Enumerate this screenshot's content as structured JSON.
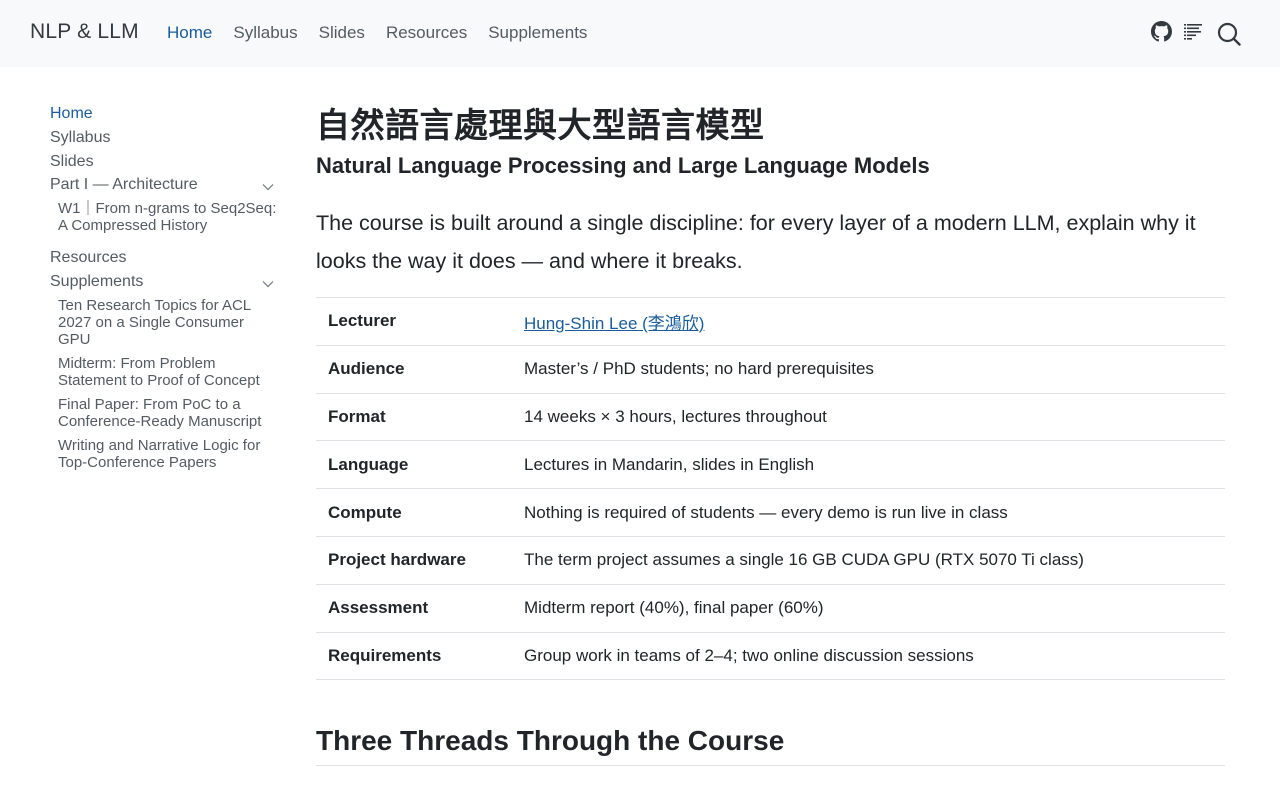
{
  "header": {
    "brand": "NLP & LLM",
    "nav": [
      {
        "label": "Home",
        "active": true
      },
      {
        "label": "Syllabus",
        "active": false
      },
      {
        "label": "Slides",
        "active": false
      },
      {
        "label": "Resources",
        "active": false
      },
      {
        "label": "Supplements",
        "active": false
      }
    ],
    "icons": [
      "github-icon",
      "toc-icon",
      "search-icon"
    ]
  },
  "sidebar": {
    "items": [
      {
        "label": "Home",
        "active": true
      },
      {
        "label": "Syllabus"
      },
      {
        "label": "Slides"
      },
      {
        "label": "Part I — Architecture",
        "expanded": true
      },
      {
        "label": "Resources"
      },
      {
        "label": "Supplements",
        "expanded": true
      }
    ],
    "part1_children": [
      "W1｜From n-grams to Seq2Seq: A Compressed History"
    ],
    "supplements_children": [
      "Ten Research Topics for ACL 2027 on a Single Consumer GPU",
      "Midterm: From Problem Statement to Proof of Concept",
      "Final Paper: From PoC to a Conference-Ready Manuscript",
      "Writing and Narrative Logic for Top-Conference Papers"
    ]
  },
  "main": {
    "title_cjk": "自然語言處理與大型語言模型",
    "subtitle": "Natural Language Processing and Large Language Models",
    "lead": "The course is built around a single discipline: for every layer of a modern LLM, explain why it looks the way it does — and where it breaks.",
    "info_rows": [
      {
        "key": "Lecturer",
        "value": "Hung-Shin Lee (李鴻欣)",
        "link": true
      },
      {
        "key": "Audience",
        "value": "Master’s / PhD students; no hard prerequisites"
      },
      {
        "key": "Format",
        "value": "14 weeks × 3 hours, lectures throughout"
      },
      {
        "key": "Language",
        "value": "Lectures in Mandarin, slides in English"
      },
      {
        "key": "Compute",
        "value": "Nothing is required of students — every demo is run live in class"
      },
      {
        "key": "Project hardware",
        "value": "The term project assumes a single 16 GB CUDA GPU (RTX 5070 Ti class)"
      },
      {
        "key": "Assessment",
        "value": "Midterm report (40%), final paper (60%)"
      },
      {
        "key": "Requirements",
        "value": "Group work in teams of 2–4; two online discussion sessions"
      }
    ],
    "section_heading": "Three Threads Through the Course"
  },
  "colors": {
    "accent": "#1a5c9c",
    "topbar_bg": "#f8f9fa",
    "border": "#dee2e6",
    "text": "#212529",
    "muted": "#545b62"
  }
}
